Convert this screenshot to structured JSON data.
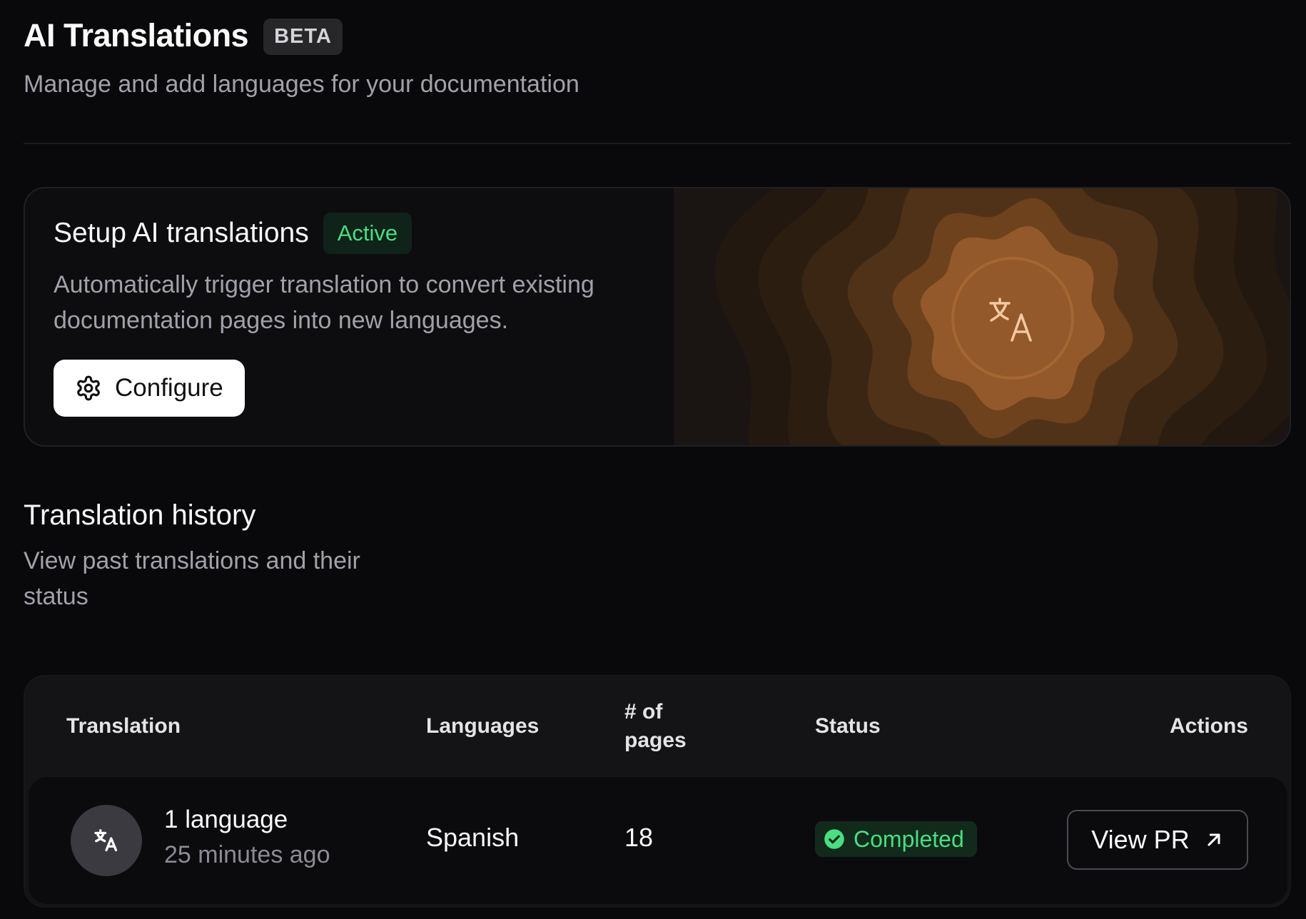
{
  "header": {
    "title": "AI Translations",
    "badge": "BETA",
    "subtitle": "Manage and add languages for your documentation"
  },
  "setup": {
    "title": "Setup AI translations",
    "status_badge": "Active",
    "description": "Automatically trigger translation to convert existing documentation pages into new languages.",
    "configure_label": "Configure",
    "art_icon": "translate-icon"
  },
  "history": {
    "title": "Translation history",
    "description": "View past translations and their status"
  },
  "table": {
    "columns": {
      "translation": "Translation",
      "languages": "Languages",
      "pages": "# of pages",
      "status": "Status",
      "actions": "Actions"
    },
    "rows": [
      {
        "title": "1 language",
        "time": "25 minutes ago",
        "language": "Spanish",
        "pages": "18",
        "status": "Completed",
        "action_label": "View PR"
      }
    ]
  },
  "colors": {
    "background": "#09090b",
    "accent_green": "#4ade80",
    "art_orange": "#a8682f"
  }
}
